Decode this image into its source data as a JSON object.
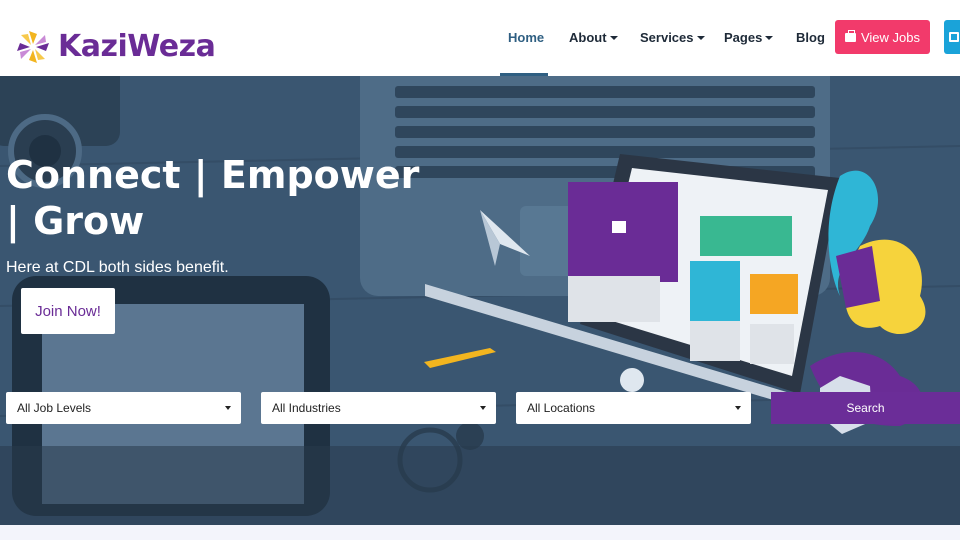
{
  "brand": {
    "name": "KaziWeza"
  },
  "nav": {
    "items": [
      {
        "label": "Home",
        "active": true,
        "has_dropdown": false
      },
      {
        "label": "About",
        "active": false,
        "has_dropdown": true
      },
      {
        "label": "Services",
        "active": false,
        "has_dropdown": true
      },
      {
        "label": "Pages",
        "active": false,
        "has_dropdown": true
      },
      {
        "label": "Blog",
        "active": false,
        "has_dropdown": false
      }
    ],
    "cta_label": "View Jobs",
    "cta_icon": "briefcase-icon",
    "cta_color": "#f23a6b",
    "active_color": "#2f5f82"
  },
  "hero": {
    "headline": "Connect | Empower | Grow",
    "subline": "Here at CDL both sides benefit.",
    "join_label": "Join Now!"
  },
  "search": {
    "job_level": "All Job Levels",
    "industry": "All Industries",
    "location": "All Locations",
    "button_label": "Search",
    "button_color": "#6b2d98"
  },
  "colors": {
    "brand_purple": "#6a2c96",
    "hero_overlay": "#3b5873"
  }
}
